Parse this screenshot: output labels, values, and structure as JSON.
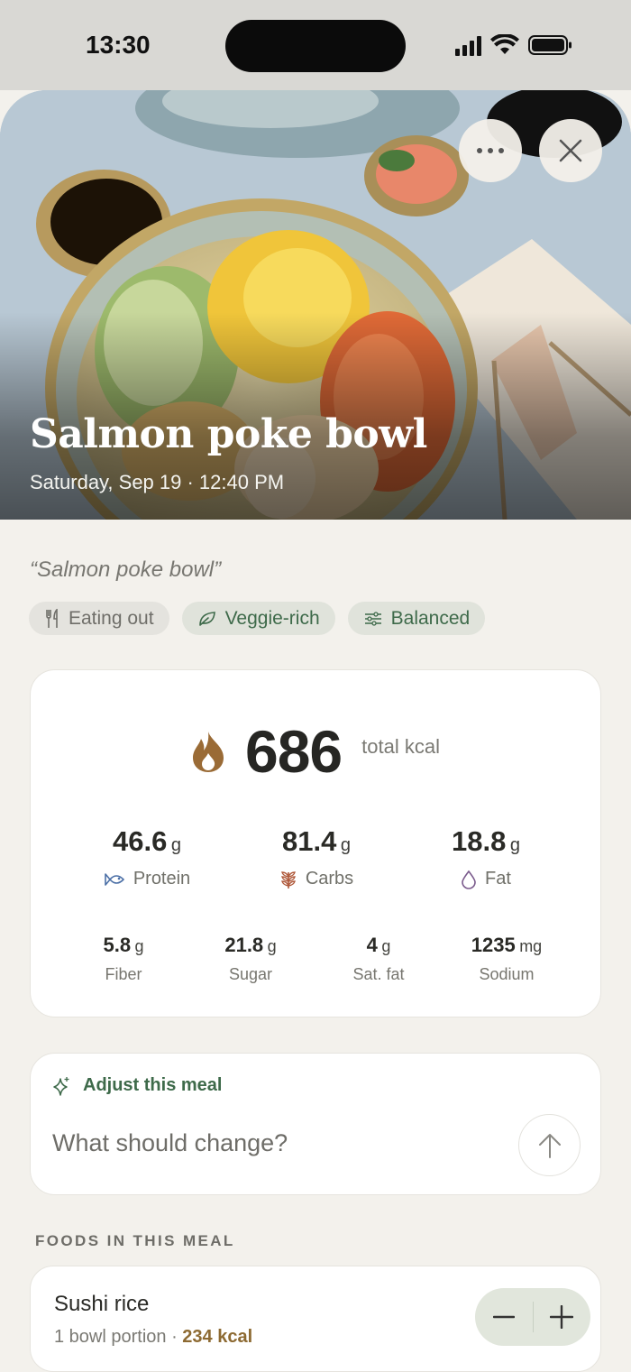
{
  "status_bar": {
    "time": "13:30"
  },
  "hero": {
    "title": "Salmon poke bowl",
    "subtitle": "Saturday, Sep 19 · 12:40 PM",
    "more_icon": "more-horizontal-icon",
    "close_icon": "close-icon"
  },
  "meal": {
    "quote": "“Salmon poke bowl”",
    "tags": [
      {
        "label": "Eating out",
        "icon": "fork-knife-icon"
      },
      {
        "label": "Veggie-rich",
        "icon": "leaf-icon"
      },
      {
        "label": "Balanced",
        "icon": "sliders-icon"
      }
    ]
  },
  "nutrition": {
    "kcal_value": "686",
    "kcal_label": "total kcal",
    "macros": [
      {
        "value": "46.6",
        "unit": "g",
        "label": "Protein",
        "icon": "fish-icon"
      },
      {
        "value": "81.4",
        "unit": "g",
        "label": "Carbs",
        "icon": "wheat-icon"
      },
      {
        "value": "18.8",
        "unit": "g",
        "label": "Fat",
        "icon": "droplet-icon"
      }
    ],
    "micros": [
      {
        "value": "5.8",
        "unit": "g",
        "label": "Fiber"
      },
      {
        "value": "21.8",
        "unit": "g",
        "label": "Sugar"
      },
      {
        "value": "4",
        "unit": "g",
        "label": "Sat. fat"
      },
      {
        "value": "1235",
        "unit": "mg",
        "label": "Sodium"
      }
    ]
  },
  "adjust": {
    "title": "Adjust this meal",
    "placeholder": "What should change?"
  },
  "foods": {
    "section_title": "FOODS IN THIS MEAL",
    "items": [
      {
        "name": "Sushi rice",
        "portion": "1 bowl portion · ",
        "kcal": "234 kcal"
      }
    ]
  },
  "colors": {
    "accent_green": "#3e6a4a",
    "kcal_brown": "#8d6a32",
    "flame": "#9a6b36"
  }
}
